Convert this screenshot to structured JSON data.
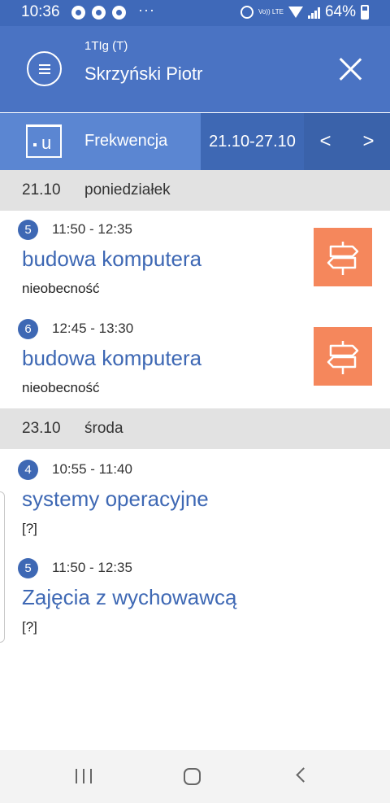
{
  "status_bar": {
    "time": "10:36",
    "dots": "···",
    "volte": "Vo)) LTE",
    "battery": "64%"
  },
  "header": {
    "class_label": "1TIg (T)",
    "student_name": "Skrzyński  Piotr",
    "menu_icon": "hamburger-menu-icon",
    "close_icon": "close-x-icon"
  },
  "module": {
    "icon_letter": "u",
    "title": "Frekwencja",
    "date_range": "21.10-27.10",
    "prev": "<",
    "next": ">"
  },
  "colors": {
    "header": "#4a73c3",
    "accent": "#3e68b4",
    "absence": "#f5875c",
    "day_header_bg": "#e2e2e2"
  },
  "days": [
    {
      "date": "21.10",
      "weekday": "poniedziałek",
      "lessons": [
        {
          "number": "5",
          "time": "11:50 - 12:35",
          "subject": "budowa komputera",
          "status": "nieobecność",
          "icon": "signpost-icon"
        },
        {
          "number": "6",
          "time": "12:45 - 13:30",
          "subject": "budowa komputera",
          "status": "nieobecność",
          "icon": "signpost-icon"
        }
      ]
    },
    {
      "date": "23.10",
      "weekday": "środa",
      "lessons": [
        {
          "number": "4",
          "time": "10:55 - 11:40",
          "subject": "systemy operacyjne",
          "status": "[?]"
        },
        {
          "number": "5",
          "time": "11:50 - 12:35",
          "subject": "Zajęcia z wychowawcą",
          "status": "[?]"
        }
      ]
    }
  ]
}
